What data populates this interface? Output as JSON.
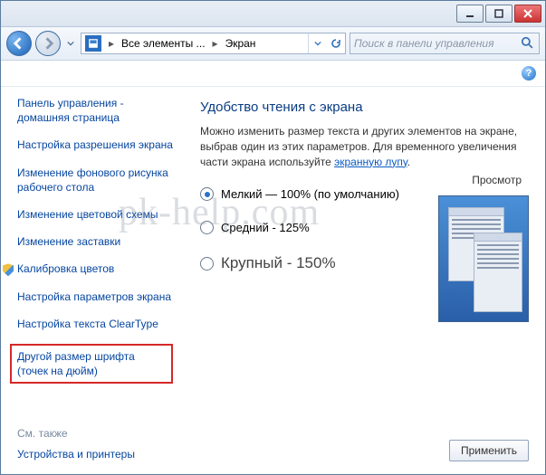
{
  "titlebar": {
    "min_icon": "minimize-icon",
    "max_icon": "maximize-icon",
    "close_icon": "close-icon"
  },
  "nav": {
    "breadcrumb1": "Все элементы ...",
    "breadcrumb2": "Экран",
    "search_placeholder": "Поиск в панели управления"
  },
  "sidebar": {
    "home": "Панель управления - домашняя страница",
    "items": [
      "Настройка разрешения экрана",
      "Изменение фонового рисунка рабочего стола",
      "Изменение цветовой схемы",
      "Изменение заставки",
      "Калибровка цветов",
      "Настройка параметров экрана",
      "Настройка текста ClearType",
      "Другой размер шрифта (точек на дюйм)"
    ],
    "see_also": "См. также",
    "devices": "Устройства и принтеры"
  },
  "content": {
    "title": "Удобство чтения с экрана",
    "desc_before": "Можно изменить размер текста и других элементов на экране, выбрав один из этих параметров. Для временного увеличения части экрана используйте ",
    "desc_link": "экранную лупу",
    "desc_after": ".",
    "options": [
      {
        "label": "Мелкий — 100% (по умолчанию)",
        "checked": true
      },
      {
        "label": "Средний - 125%",
        "checked": false
      },
      {
        "label": "Крупный - 150%",
        "checked": false
      }
    ],
    "preview_label": "Просмотр",
    "apply": "Применить"
  },
  "watermark": "pk-help.com"
}
